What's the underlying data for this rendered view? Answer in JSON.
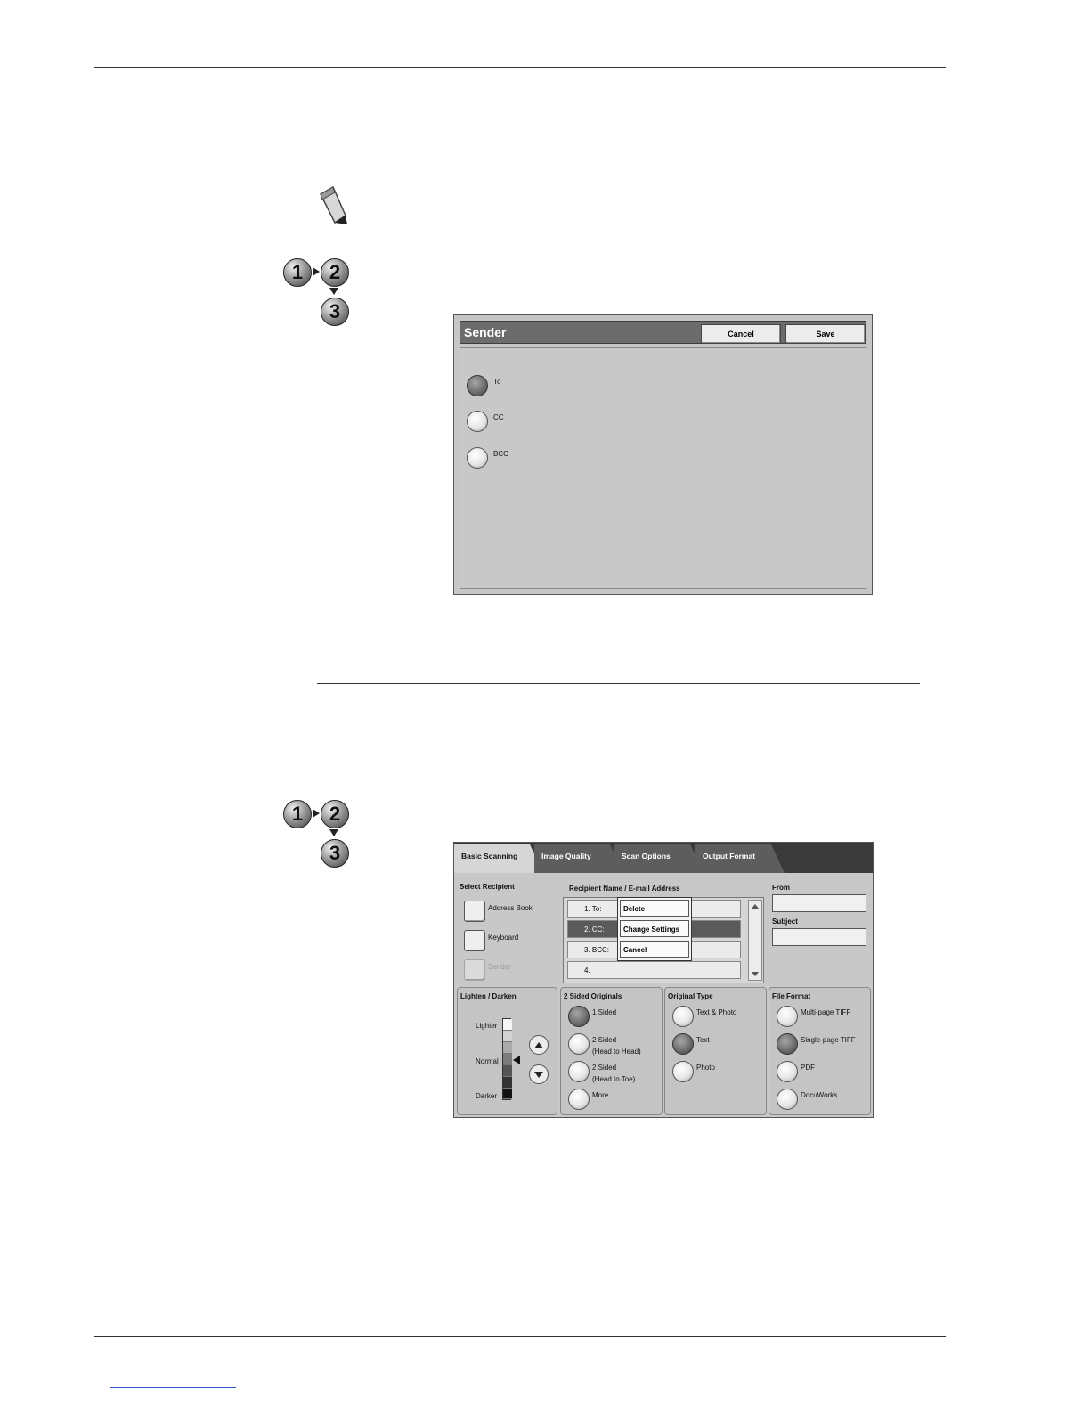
{
  "sender_dialog": {
    "title": "Sender",
    "cancel_label": "Cancel",
    "save_label": "Save",
    "options": [
      {
        "label": "To",
        "selected": true
      },
      {
        "label": "CC",
        "selected": false
      },
      {
        "label": "BCC",
        "selected": false
      }
    ]
  },
  "steps_icon": {
    "one": "1",
    "two": "2",
    "three": "3"
  },
  "scan_screen": {
    "tabs": [
      "Basic Scanning",
      "Image Quality",
      "Scan Options",
      "Output Format"
    ],
    "select_recipient": {
      "heading": "Select Recipient",
      "buttons": [
        "Address Book",
        "Keyboard",
        "Sender"
      ]
    },
    "recipients": {
      "heading": "Recipient Name / E-mail Address",
      "rows": [
        "1.  To:",
        "2.  CC:",
        "3.  BCC:",
        "4."
      ],
      "menu": [
        "Delete",
        "Change Settings",
        "Cancel"
      ]
    },
    "from_label": "From",
    "subject_label": "Subject",
    "lighten_darken": {
      "heading": "Lighten / Darken",
      "lighter": "Lighter",
      "normal": "Normal",
      "darker": "Darker"
    },
    "two_sided": {
      "heading": "2 Sided Originals",
      "options": [
        "1 Sided",
        "2 Sided",
        "(Head to Head)",
        "2 Sided",
        "(Head to Toe)",
        "More..."
      ]
    },
    "original_type": {
      "heading": "Original Type",
      "options": [
        "Text & Photo",
        "Text",
        "Photo"
      ]
    },
    "file_format": {
      "heading": "File Format",
      "options": [
        "Multi-page TIFF",
        "Single-page TIFF",
        "PDF",
        "DocuWorks"
      ]
    }
  },
  "colors": {
    "tab_active": "#d6d6d6",
    "tab_inactive": "#5d5d5d",
    "screen_bg": "#c6c6c6"
  }
}
